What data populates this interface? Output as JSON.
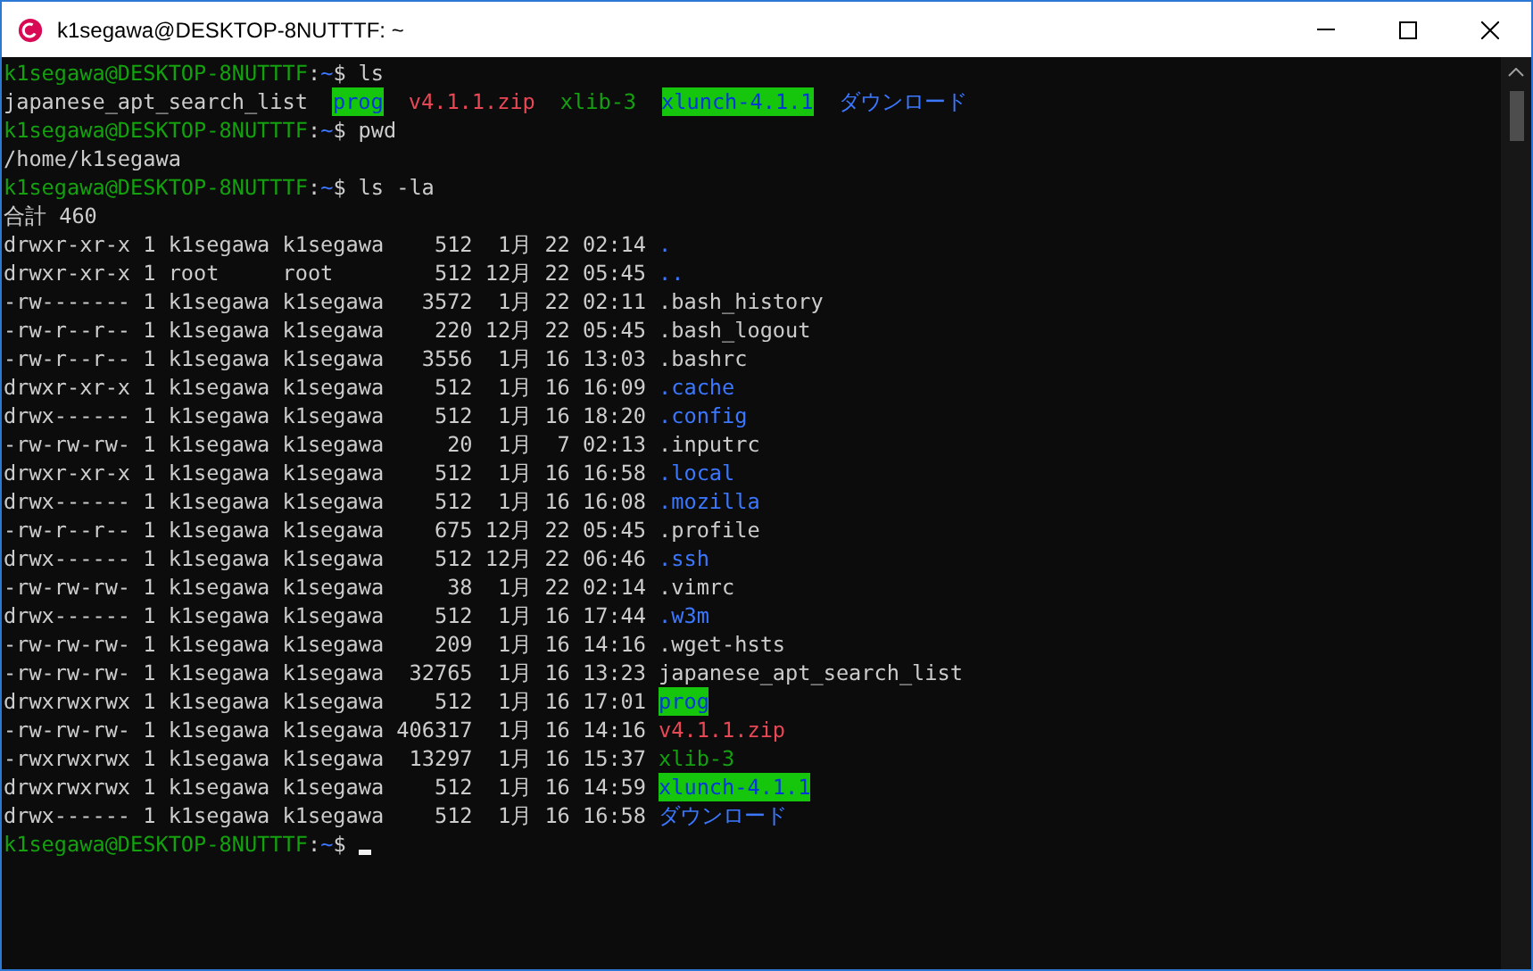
{
  "window": {
    "title": "k1segawa@DESKTOP-8NUTTTF: ~"
  },
  "terminal": {
    "lines": [
      {
        "kind": "prompt",
        "user": "k1segawa@DESKTOP-8NUTTTF",
        "separator": ":",
        "path": "~",
        "symbol": "$",
        "command": "ls"
      },
      {
        "kind": "output",
        "segments": [
          {
            "text": "japanese_apt_search_list",
            "kind": "plain"
          },
          {
            "text": "prog",
            "kind": "sticky-dir"
          },
          {
            "text": "v4.1.1.zip",
            "kind": "archive"
          },
          {
            "text": "xlib-3",
            "kind": "exec"
          },
          {
            "text": "xlunch-4.1.1",
            "kind": "sticky-dir"
          },
          {
            "text": "ダウンロード",
            "kind": "dir"
          }
        ]
      },
      {
        "kind": "prompt",
        "user": "k1segawa@DESKTOP-8NUTTTF",
        "separator": ":",
        "path": "~",
        "symbol": "$",
        "command": "pwd"
      },
      {
        "kind": "output",
        "segments": [
          {
            "text": "/home/k1segawa",
            "kind": "plain"
          }
        ]
      },
      {
        "kind": "prompt",
        "user": "k1segawa@DESKTOP-8NUTTTF",
        "separator": ":",
        "path": "~",
        "symbol": "$",
        "command": "ls -la"
      },
      {
        "kind": "output",
        "segments": [
          {
            "text": "合計 460",
            "kind": "plain"
          }
        ]
      },
      {
        "kind": "listing",
        "info": "drwxr-xr-x 1 k1segawa k1segawa    512  1月 22 02:14",
        "name": {
          "text": ".",
          "kind": "dir"
        }
      },
      {
        "kind": "listing",
        "info": "drwxr-xr-x 1 root     root        512 12月 22 05:45",
        "name": {
          "text": "..",
          "kind": "dir"
        }
      },
      {
        "kind": "listing",
        "info": "-rw------- 1 k1segawa k1segawa   3572  1月 22 02:11",
        "name": {
          "text": ".bash_history",
          "kind": "plain"
        }
      },
      {
        "kind": "listing",
        "info": "-rw-r--r-- 1 k1segawa k1segawa    220 12月 22 05:45",
        "name": {
          "text": ".bash_logout",
          "kind": "plain"
        }
      },
      {
        "kind": "listing",
        "info": "-rw-r--r-- 1 k1segawa k1segawa   3556  1月 16 13:03",
        "name": {
          "text": ".bashrc",
          "kind": "plain"
        }
      },
      {
        "kind": "listing",
        "info": "drwxr-xr-x 1 k1segawa k1segawa    512  1月 16 16:09",
        "name": {
          "text": ".cache",
          "kind": "dir"
        }
      },
      {
        "kind": "listing",
        "info": "drwx------ 1 k1segawa k1segawa    512  1月 16 18:20",
        "name": {
          "text": ".config",
          "kind": "dir"
        }
      },
      {
        "kind": "listing",
        "info": "-rw-rw-rw- 1 k1segawa k1segawa     20  1月  7 02:13",
        "name": {
          "text": ".inputrc",
          "kind": "plain"
        }
      },
      {
        "kind": "listing",
        "info": "drwxr-xr-x 1 k1segawa k1segawa    512  1月 16 16:58",
        "name": {
          "text": ".local",
          "kind": "dir"
        }
      },
      {
        "kind": "listing",
        "info": "drwx------ 1 k1segawa k1segawa    512  1月 16 16:08",
        "name": {
          "text": ".mozilla",
          "kind": "dir"
        }
      },
      {
        "kind": "listing",
        "info": "-rw-r--r-- 1 k1segawa k1segawa    675 12月 22 05:45",
        "name": {
          "text": ".profile",
          "kind": "plain"
        }
      },
      {
        "kind": "listing",
        "info": "drwx------ 1 k1segawa k1segawa    512 12月 22 06:46",
        "name": {
          "text": ".ssh",
          "kind": "dir"
        }
      },
      {
        "kind": "listing",
        "info": "-rw-rw-rw- 1 k1segawa k1segawa     38  1月 22 02:14",
        "name": {
          "text": ".vimrc",
          "kind": "plain"
        }
      },
      {
        "kind": "listing",
        "info": "drwx------ 1 k1segawa k1segawa    512  1月 16 17:44",
        "name": {
          "text": ".w3m",
          "kind": "dir"
        }
      },
      {
        "kind": "listing",
        "info": "-rw-rw-rw- 1 k1segawa k1segawa    209  1月 16 14:16",
        "name": {
          "text": ".wget-hsts",
          "kind": "plain"
        }
      },
      {
        "kind": "listing",
        "info": "-rw-rw-rw- 1 k1segawa k1segawa  32765  1月 16 13:23",
        "name": {
          "text": "japanese_apt_search_list",
          "kind": "plain"
        }
      },
      {
        "kind": "listing",
        "info": "drwxrwxrwx 1 k1segawa k1segawa    512  1月 16 17:01",
        "name": {
          "text": "prog",
          "kind": "sticky-dir"
        }
      },
      {
        "kind": "listing",
        "info": "-rw-rw-rw- 1 k1segawa k1segawa 406317  1月 16 14:16",
        "name": {
          "text": "v4.1.1.zip",
          "kind": "archive"
        }
      },
      {
        "kind": "listing",
        "info": "-rwxrwxrwx 1 k1segawa k1segawa  13297  1月 16 15:37",
        "name": {
          "text": "xlib-3",
          "kind": "exec"
        }
      },
      {
        "kind": "listing",
        "info": "drwxrwxrwx 1 k1segawa k1segawa    512  1月 16 14:59",
        "name": {
          "text": "xlunch-4.1.1",
          "kind": "sticky-dir"
        }
      },
      {
        "kind": "listing",
        "info": "drwx------ 1 k1segawa k1segawa    512  1月 16 16:58",
        "name": {
          "text": "ダウンロード",
          "kind": "dir"
        }
      },
      {
        "kind": "prompt",
        "user": "k1segawa@DESKTOP-8NUTTTF",
        "separator": ":",
        "path": "~",
        "symbol": "$",
        "cursor": true
      }
    ]
  }
}
